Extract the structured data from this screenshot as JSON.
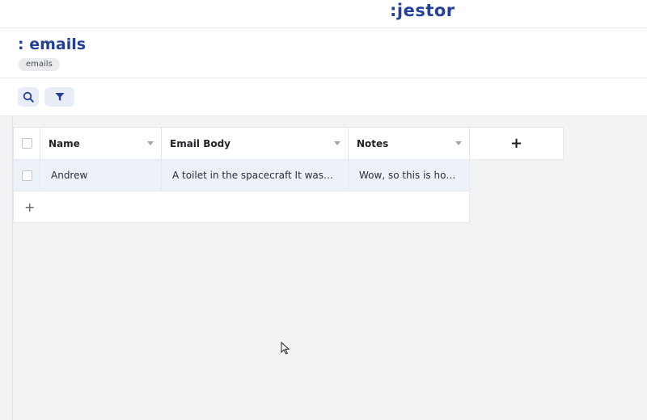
{
  "app": {
    "logo": ":jestor",
    "brand_color": "#23409a"
  },
  "page": {
    "title": ": emails",
    "tag": "emails"
  },
  "toolbar": {
    "search_icon": "search-icon",
    "filter_icon": "filter-icon"
  },
  "table": {
    "columns": [
      {
        "label": "Name"
      },
      {
        "label": "Email Body"
      },
      {
        "label": "Notes"
      }
    ],
    "add_column_label": "+",
    "rows": [
      {
        "name": "Andrew",
        "email_body": "A toilet in the spacecraft It was ann...",
        "notes": "Wow, so this is how it..."
      }
    ],
    "add_row_label": "+"
  }
}
